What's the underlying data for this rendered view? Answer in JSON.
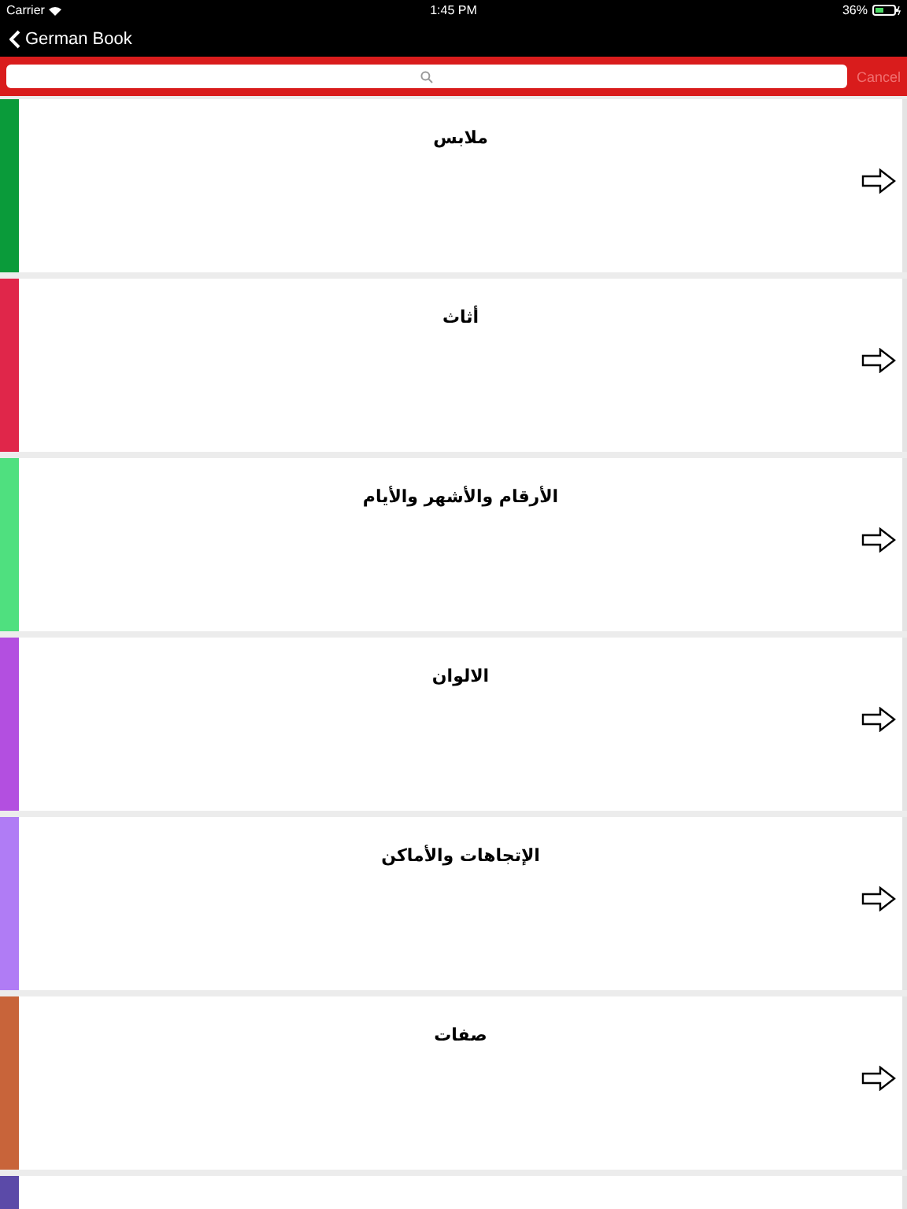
{
  "status_bar": {
    "carrier": "Carrier",
    "time": "1:45 PM",
    "battery": "36%"
  },
  "nav": {
    "back": "German Book"
  },
  "search": {
    "cancel": "Cancel"
  },
  "categories": [
    {
      "title": "ملابس",
      "color": "#0a9b3a"
    },
    {
      "title": "أثاث",
      "color": "#e0264a"
    },
    {
      "title": "الأرقام والأشهر والأيام",
      "color": "#4fe07f"
    },
    {
      "title": "الالوان",
      "color": "#b34fe0"
    },
    {
      "title": "الإتجاهات والأماكن",
      "color": "#b07cf5"
    },
    {
      "title": "صفات",
      "color": "#c8643a"
    },
    {
      "color": "#5b4aa8"
    }
  ]
}
